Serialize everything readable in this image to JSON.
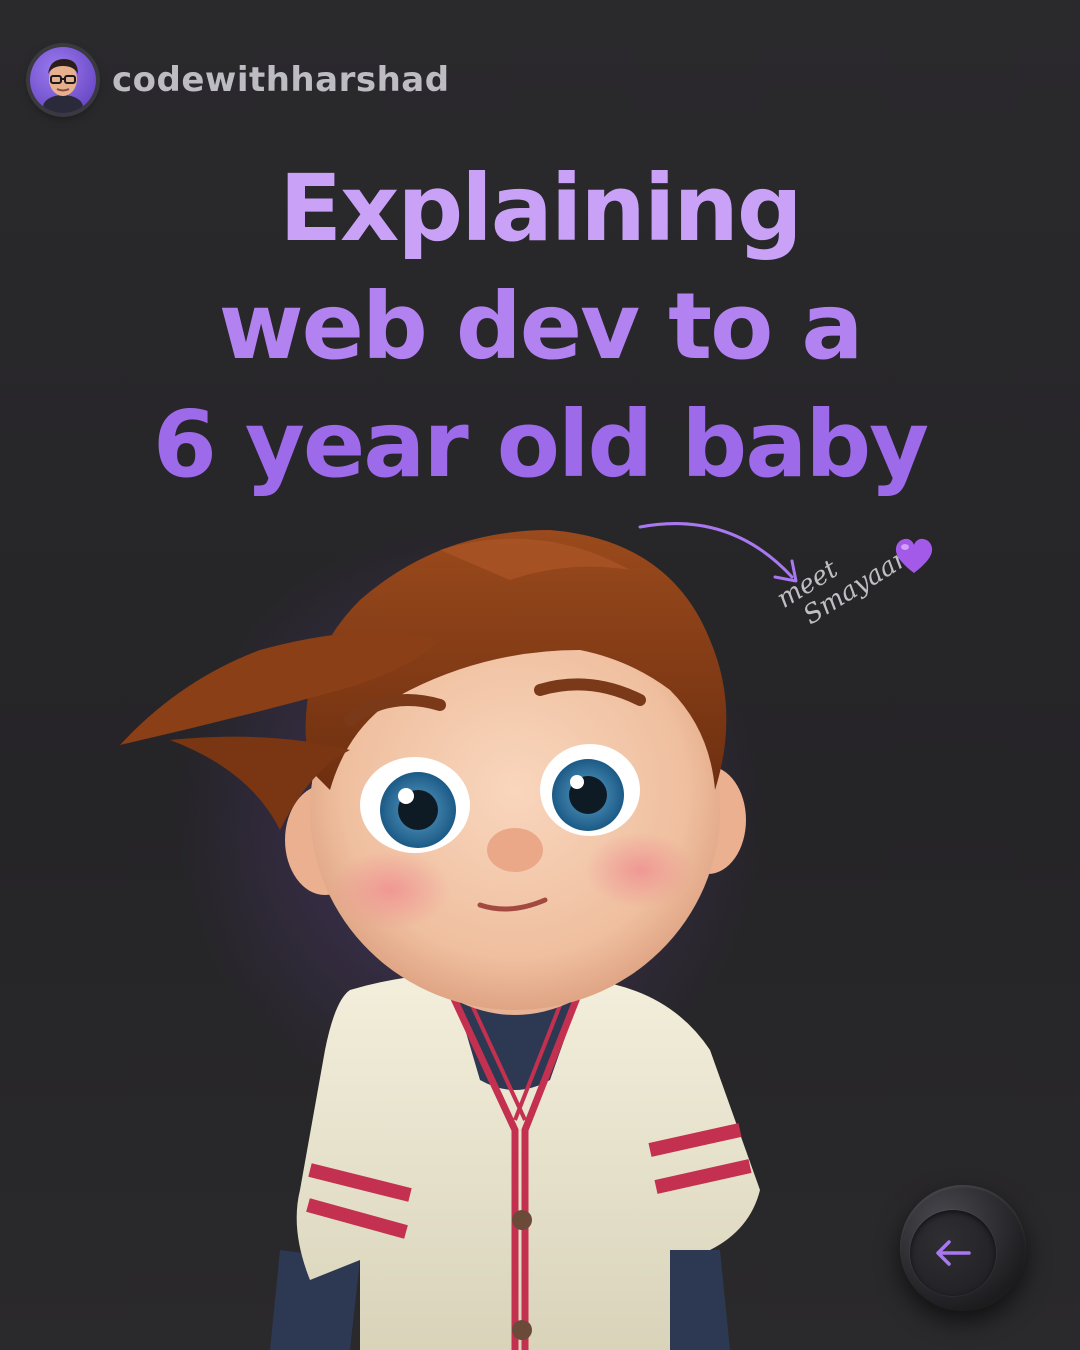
{
  "handle": {
    "username": "codewithharshad"
  },
  "headline": {
    "line1": "Explaining",
    "line2": "web dev to a",
    "line3": "6 year old baby"
  },
  "annotation": {
    "line1": "meet",
    "line2": "Smayaan"
  },
  "icons": {
    "avatar": "avatar-icon",
    "heart": "purple-heart-icon",
    "arrow": "curved-arrow-icon",
    "nav": "arrow-left-icon"
  },
  "colors": {
    "background": "#262527",
    "accent": "#a978f0",
    "headline_light": "#c9a2f7",
    "headline_dark": "#9d6aea"
  }
}
